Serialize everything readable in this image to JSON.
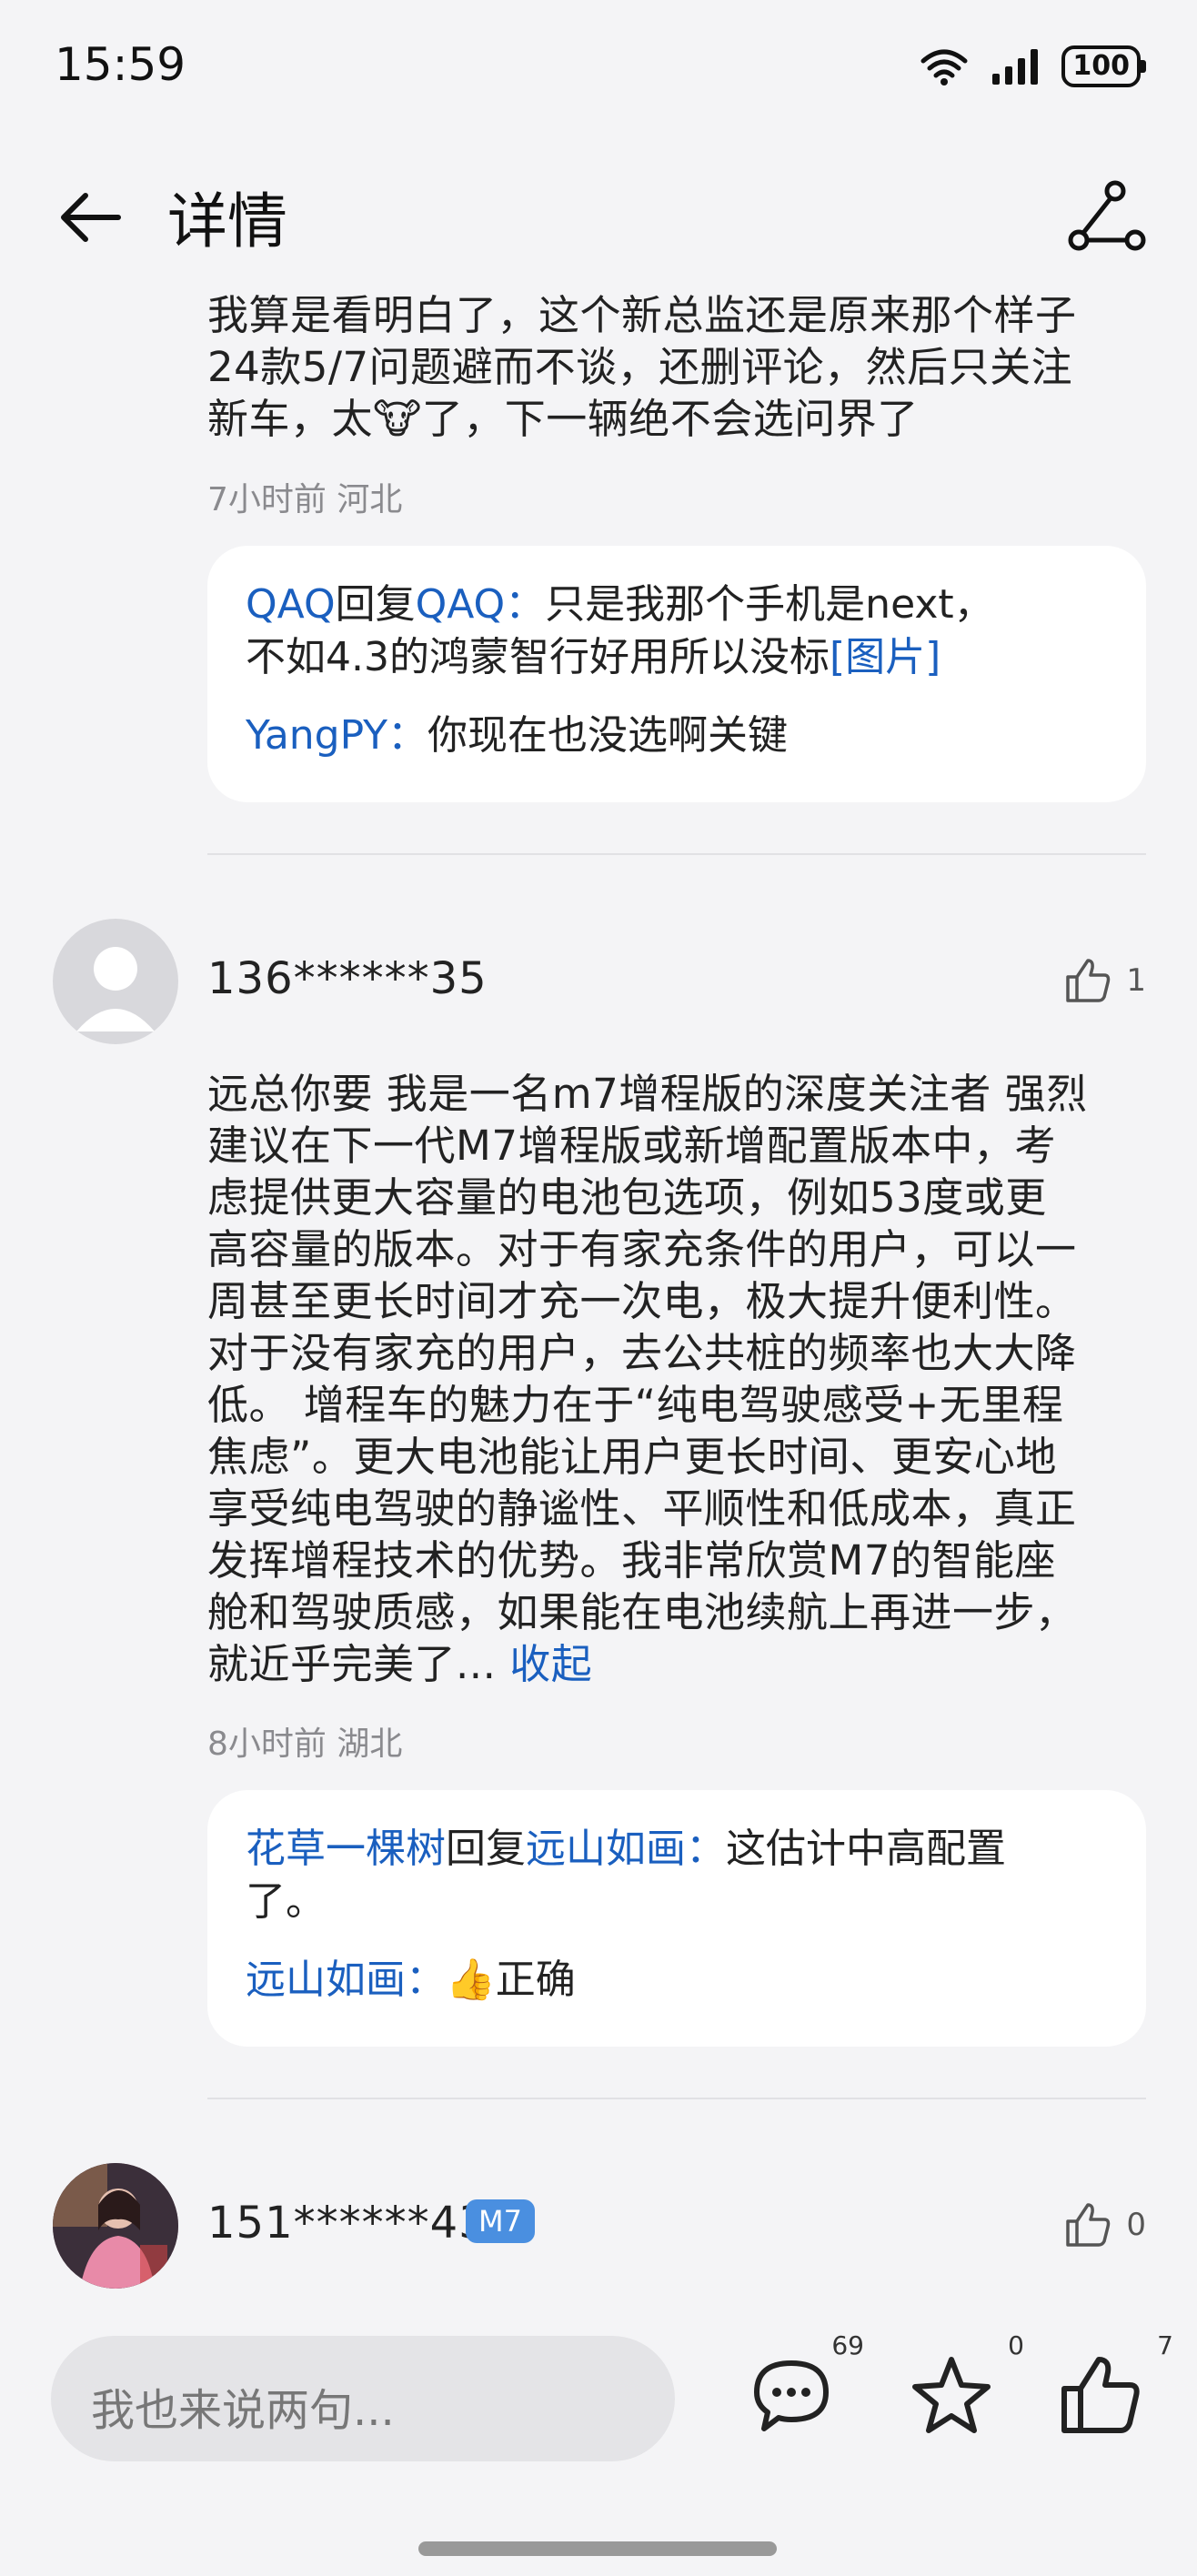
{
  "status_bar": {
    "time": "15:59",
    "battery": "100"
  },
  "header": {
    "title": "详情"
  },
  "comments": [
    {
      "text_lines": [
        "我算是看明白了，这个新总监还是原来那个样子",
        "24款5/7问题避而不谈，还删评论，然后只关注",
        "新车，太🐮了，下一辆绝不会选问界了"
      ],
      "meta": "7小时前 河北",
      "replies": [
        {
          "from": "QAQ",
          "reply_word": "回复",
          "to": "QAQ",
          "sep": "：",
          "text1": "只是我那个手机是next，",
          "text2": "不如4.3的鸿蒙智行好用所以没标",
          "link": "[图片]"
        },
        {
          "from": "YangPY",
          "sep": "：",
          "text": "你现在也没选啊关键"
        }
      ]
    },
    {
      "username": "136******35",
      "likes": "1",
      "text_lines": [
        "远总你要 我是一名m7增程版的深度关注者 强烈",
        "建议在下一代M7增程版或新增配置版本中，考",
        "虑提供更大容量的电池包选项，例如53度或更",
        "高容量的版本。对于有家充条件的用户，可以一",
        "周甚至更长时间才充一次电，极大提升便利性。",
        "对于没有家充的用户，去公共桩的频率也大大降",
        "低。 增程车的魅力在于“纯电驾驶感受+无里程",
        "焦虑”。更大电池能让用户更长时间、更安心地",
        "享受纯电驾驶的静谧性、平顺性和低成本，真正",
        "发挥增程技术的优势。我非常欣赏M7的智能座",
        "舱和驾驶质感，如果能在电池续航上再进一步，",
        "就近乎完美了..."
      ],
      "collapse": "收起",
      "meta": "8小时前 湖北",
      "replies": [
        {
          "from": "花草一棵树",
          "reply_word": "回复",
          "to": "远山如画",
          "sep": "：",
          "text1": "这估计中高配置",
          "text2": "了。"
        },
        {
          "from": "远山如画",
          "sep": "：",
          "text": "👍正确"
        }
      ]
    },
    {
      "username": "151******43",
      "badge": "M7",
      "likes": "0"
    }
  ],
  "bottom_bar": {
    "placeholder": "我也来说两句...",
    "comment_count": "69",
    "favorite_count": "0",
    "like_count": "7"
  }
}
